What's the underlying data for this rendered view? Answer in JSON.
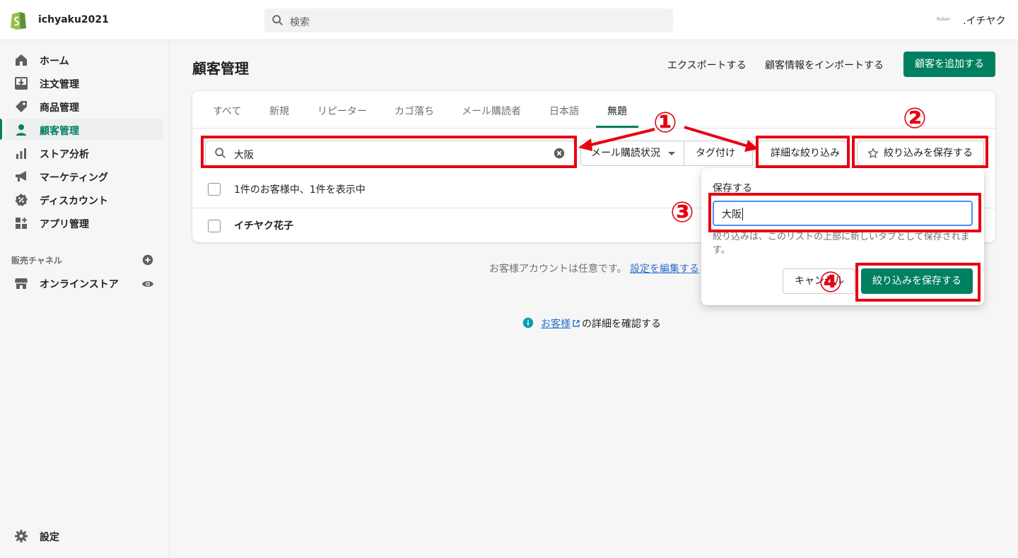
{
  "app": {
    "store_name": "ichyaku2021",
    "search_placeholder": "検索",
    "partner_badge": "Ruten",
    "user_name": ".イチヤク",
    "brand_color": "#008060",
    "annotation_color": "#e60012"
  },
  "sidebar": {
    "items": [
      {
        "label": "ホーム",
        "icon": "home-icon"
      },
      {
        "label": "注文管理",
        "icon": "orders-icon"
      },
      {
        "label": "商品管理",
        "icon": "tag-icon"
      },
      {
        "label": "顧客管理",
        "icon": "customer-icon",
        "active": true
      },
      {
        "label": "ストア分析",
        "icon": "analytics-icon"
      },
      {
        "label": "マーケティング",
        "icon": "megaphone-icon"
      },
      {
        "label": "ディスカウント",
        "icon": "discount-icon"
      },
      {
        "label": "アプリ管理",
        "icon": "apps-icon"
      }
    ],
    "channels_label": "販売チャネル",
    "online_store": "オンラインストア",
    "settings": "設定"
  },
  "page": {
    "title": "顧客管理",
    "export": "エクスポートする",
    "import": "顧客情報をインポートする",
    "add_customer": "顧客を追加する"
  },
  "tabs": [
    "すべて",
    "新規",
    "リピーター",
    "カゴ落ち",
    "メール購読者",
    "日本語",
    "無題"
  ],
  "filters": {
    "search_value": "大阪",
    "email_status": "メール購読状況",
    "tagged": "タグ付け",
    "more_filters": "詳細な絞り込み",
    "save_filter": "絞り込みを保存する"
  },
  "list": {
    "summary": "1件のお客様中、1件を表示中",
    "customers": [
      "イチヤク花子"
    ]
  },
  "footer": {
    "note_text": "お客様アカウントは任意です。",
    "note_link": "設定を編集する",
    "learn_link": "お客様",
    "learn_suffix": "の詳細を確認する"
  },
  "popover": {
    "label": "保存する",
    "value": "大阪",
    "help": "絞り込みは、このリストの上部に新しいタブとして保存されます。",
    "cancel": "キャンセル",
    "save": "絞り込みを保存する"
  },
  "annotations": [
    "①",
    "②",
    "③",
    "④"
  ]
}
